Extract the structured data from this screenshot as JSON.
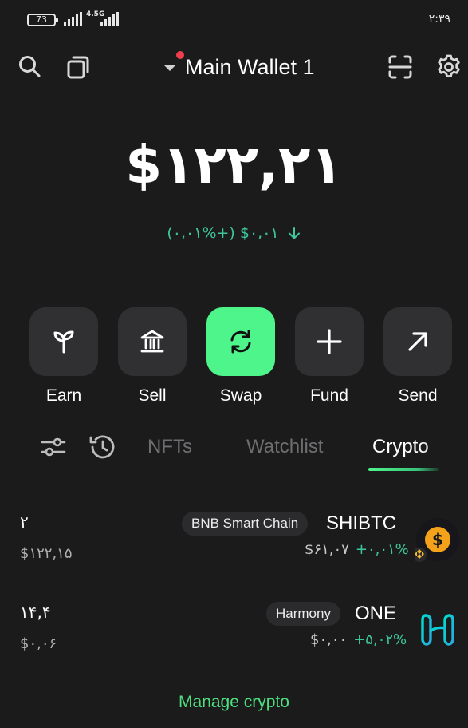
{
  "status_bar": {
    "battery": "73",
    "network": "4.5G",
    "time": "۲:۳۹"
  },
  "header": {
    "wallet_name": "Main Wallet 1"
  },
  "balance": {
    "total": "$۱۲۲,۲۱",
    "change": "(۰,۰۱%+) $۰,۰۱"
  },
  "actions": [
    {
      "label": "Earn"
    },
    {
      "label": "Sell"
    },
    {
      "label": "Swap"
    },
    {
      "label": "Fund"
    },
    {
      "label": "Send"
    }
  ],
  "tabs": {
    "nfts": "NFTs",
    "watchlist": "Watchlist",
    "crypto": "Crypto",
    "active": "Crypto"
  },
  "assets": [
    {
      "amount": "۲",
      "fiat": "$۱۲۲,۱۵",
      "chain": "BNB Smart Chain",
      "ticker": "SHIBTC",
      "price": "$۶۱,۰۷",
      "change": "+۰,۰۱%",
      "icon": "shibtc-coin-icon"
    },
    {
      "amount": "۱۴,۴",
      "fiat": "$۰,۰۶",
      "chain": "Harmony",
      "ticker": "ONE",
      "price": "$۰,۰۰",
      "change": "+۵,۰۲%",
      "icon": "harmony-one-icon"
    }
  ],
  "manage_label": "Manage crypto",
  "colors": {
    "background": "#1b1b1c",
    "accent": "#4ef58a",
    "positive": "#3ec79c",
    "tile": "#303032"
  }
}
